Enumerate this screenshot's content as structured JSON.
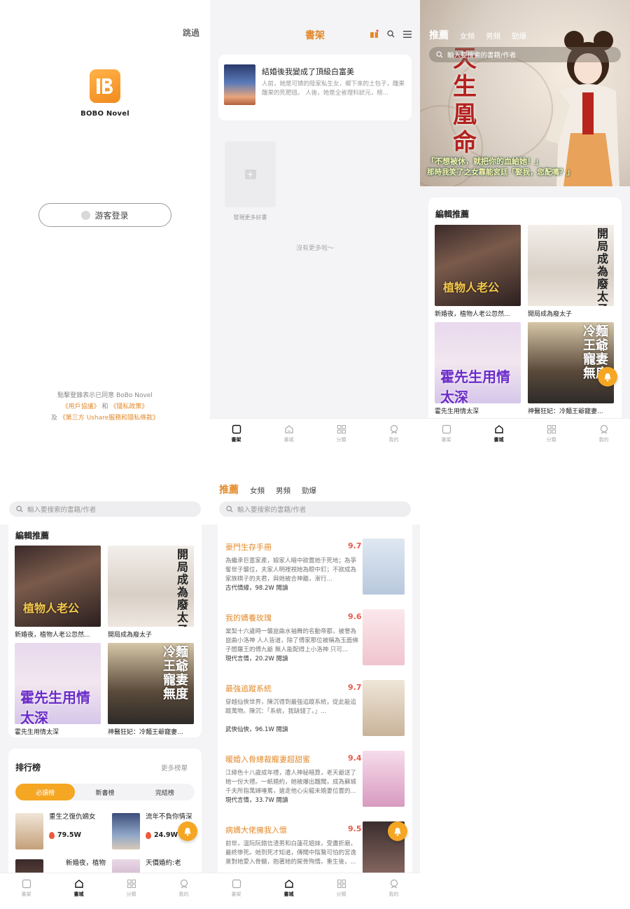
{
  "colors": {
    "accent": "#e38a2b",
    "bell": "#f5a623",
    "score": "#e85a4a"
  },
  "login": {
    "skip_label": "跳過",
    "logo_text": "BOBO Novel",
    "guest_button_label": "游客登录",
    "terms_line1": "點擊登錄表示已同意 BoBo Novel",
    "terms_user_agreement": "《用戶協議》",
    "terms_and": "和",
    "terms_privacy": "《隱私政策》",
    "terms_and_prefix": "及",
    "terms_third_party": "《第三方 Ushare服務和隱私條款》"
  },
  "tabbar": {
    "shelf": "書架",
    "store": "書城",
    "category": "分類",
    "mine": "我的"
  },
  "bookshelf": {
    "title": "書架",
    "book_title": "結婚後我變成了頂級白富美",
    "book_desc": "人前，她是可憐的陸家私生女，鄉下來的土包子，醜果醜果的死肥妞。 人後，她是全省理科狀元，榜...",
    "add_more_label": "發現更多好書",
    "no_more_label": "沒有更多啦～"
  },
  "store": {
    "tabs": [
      "推薦",
      "女頻",
      "男頻",
      "勁爆"
    ],
    "search_placeholder": "輸入要搜索的書籍/作者",
    "banner_title": "天生凰命",
    "banner_caption_1": "「不想被休，就把你的血給她！」",
    "banner_caption_2": "那時我笑了之女靠能宮廷「娶我，您配嗎？」",
    "editor_section_title": "編輯推薦",
    "editor_books": [
      {
        "name": "新婚夜，植物人老公忽然...",
        "cover_text": "植物人老公"
      },
      {
        "name": "開局成為廢太子",
        "cover_text": "開局成為廢太子"
      },
      {
        "name": "霍先生用情太深",
        "cover_text": "霍先生用情太深"
      },
      {
        "name": "神醫狂妃：冷麵王爺寵妻...",
        "cover_text": "冷麵王爺寵妻無度"
      }
    ],
    "ranking_title": "排行榜",
    "ranking_more": "更多榜單",
    "ranking_pills": [
      "必讀榜",
      "新書榜",
      "完結榜"
    ],
    "ranking_items": [
      {
        "title": "重生之復仇嫡女",
        "score": "79.5W"
      },
      {
        "title": "流年不負你情深",
        "score": "24.9W"
      },
      {
        "title": "新婚夜，植物",
        "score": ""
      },
      {
        "title": "天價婚約:老",
        "score": ""
      }
    ],
    "list_items": [
      {
        "title": "豪門生存手冊",
        "score": "9.7",
        "desc": "為繼承巨富家產，娘家人暗中欲置她于死地；為爭奪世子襲位，夫家人明裡視她為眼中釘；不欲成為家族棋子的夫君，與她被合神離，漸行...",
        "meta": "古代情緣，98.2W 閱讀"
      },
      {
        "title": "我的嬌養玫瑰",
        "score": "9.6",
        "desc": "棠梨十六歲時一襲崑曲水袖舞的名動帝都，被譽為崑曲小洛神 人人皆道，除了傅家那位被稱為玉面佛子閻羅王的傅九爺 無人能配得上小洛神 只可...",
        "meta": "現代言情，20.2W 閱讀"
      },
      {
        "title": "最強追蹤系統",
        "score": "9.7",
        "desc": "穿越仙俠世界，陳沉得到最強追蹤系統，從此能追蹤萬物。陳沉：「系統，我缺錢了。」...",
        "meta": "武俠仙俠，96.1W 閱讀"
      },
      {
        "title": "暖婚入骨總裁寵妻超甜蜜",
        "score": "9.4",
        "desc": "江緋色十八歲成年禮，遭人神秘暗算，老天爺送了她一份大禮。一紙婚約，她被爆出醜聞，成為蘇城千夫所指萬婦唾罵，搶走他心尖龍未婚妻位置的...",
        "meta": "現代言情，33.7W 閱讀"
      },
      {
        "title": "病嬌大佬擁我入懷",
        "score": "9.5",
        "desc": "前世，溫阮阮錯信渣男和白蓮花姐妹，受盡折磨，最終慘死。她到死才知道，傳聞中陰鷙可怕的宮逸景對她愛入骨髓，抱著她的屍骨殉情。重生後，...",
        "meta": ""
      }
    ]
  }
}
